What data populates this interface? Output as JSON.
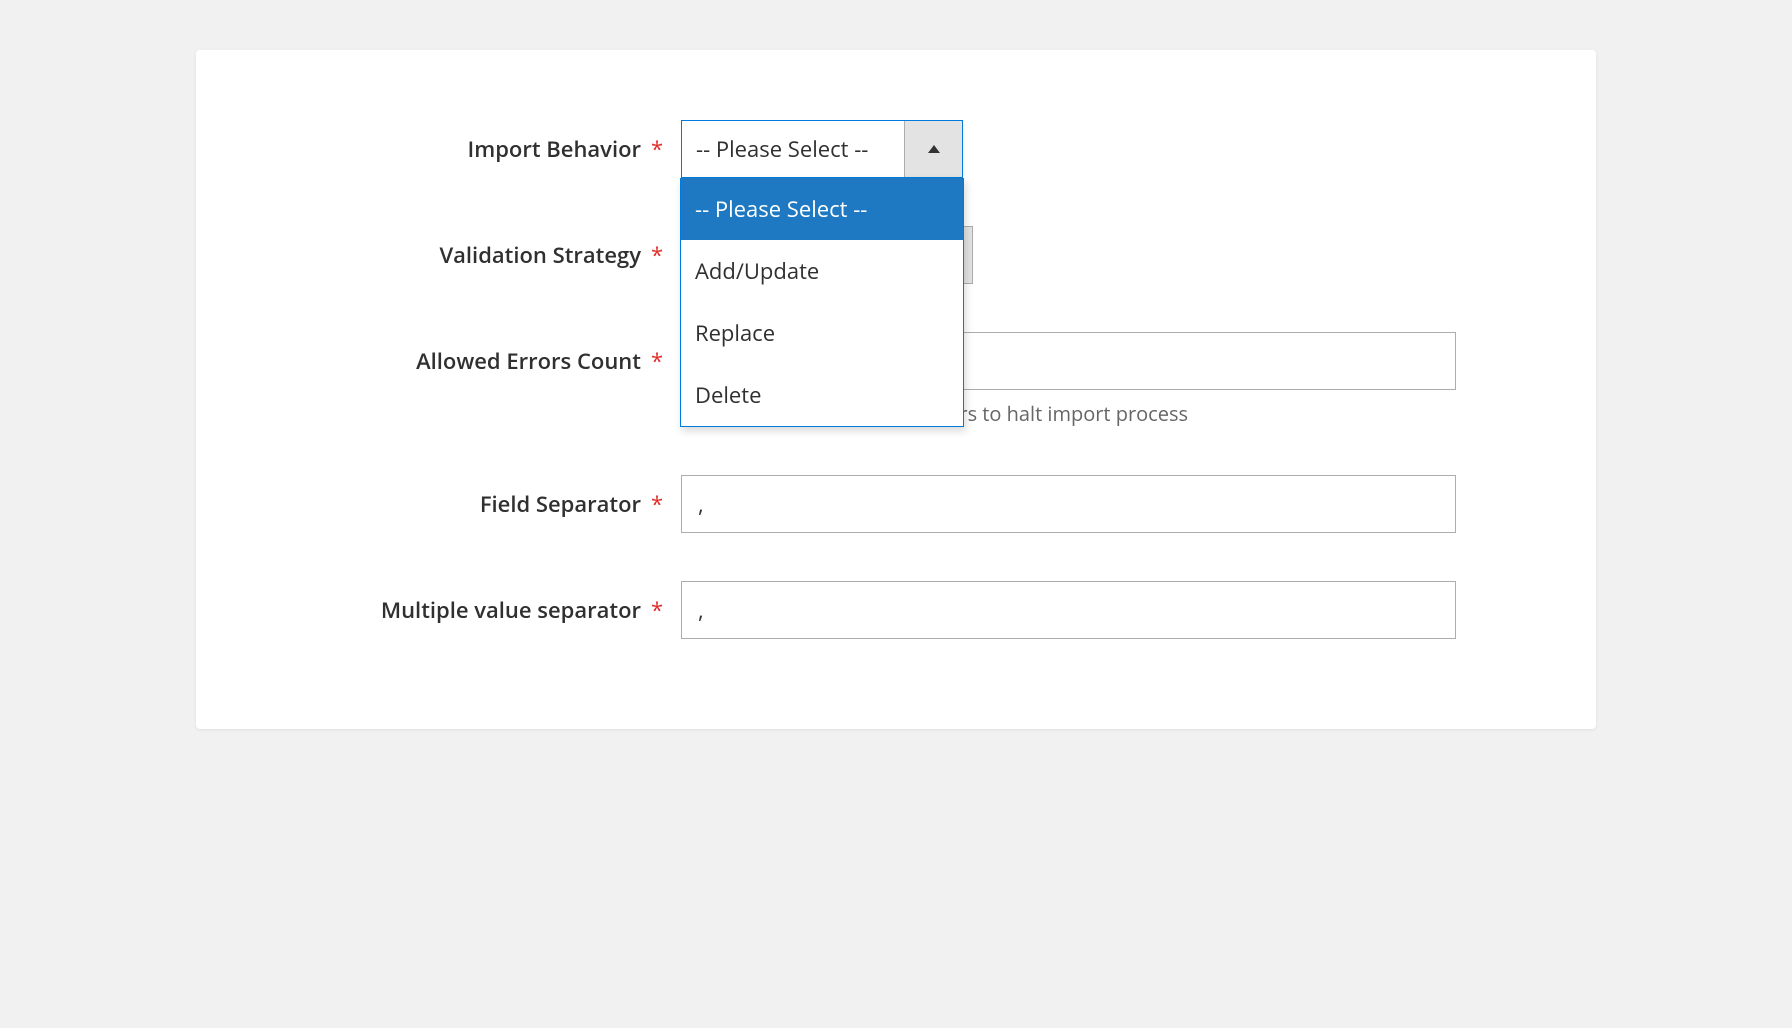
{
  "form": {
    "import_behavior": {
      "label": "Import Behavior",
      "selected": "-- Please Select --",
      "options": [
        "-- Please Select --",
        "Add/Update",
        "Replace",
        "Delete"
      ]
    },
    "validation_strategy": {
      "label": "Validation Strategy"
    },
    "allowed_errors_count": {
      "label": "Allowed Errors Count",
      "value": "",
      "helper": "Please specify number of errors to halt import process"
    },
    "field_separator": {
      "label": "Field Separator",
      "value": ","
    },
    "multiple_value_separator": {
      "label": "Multiple value separator",
      "value": ","
    },
    "required_mark": "*"
  }
}
